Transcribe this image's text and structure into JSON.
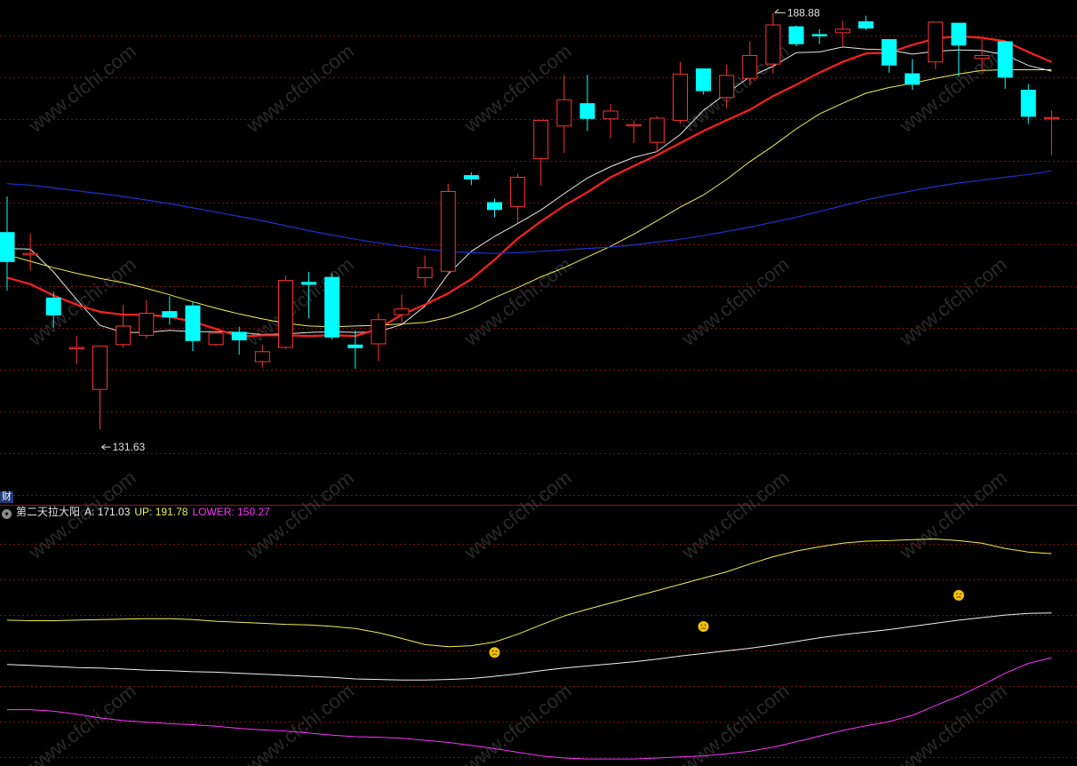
{
  "chart_data": {
    "type": "candlestick",
    "colors": {
      "up": "#ff3232",
      "down": "#00ffff",
      "ma_white": "#e8e8e8",
      "ma_red": "#ff2020",
      "ma_yellow": "#f0f050",
      "ma_blue": "#2030d0",
      "grid": "#7a1010",
      "A": "#f0f0f0",
      "UP": "#f0f050",
      "LOWER": "#ff32ff"
    },
    "price_range": [
      123.4,
      190.8
    ],
    "max_label": "188.88",
    "min_label": "131.63",
    "candles": [
      {
        "o": 159.2,
        "h": 164.2,
        "l": 151.0,
        "c": 155.0
      },
      {
        "o": 156.0,
        "h": 159.0,
        "l": 153.8,
        "c": 156.2
      },
      {
        "o": 150.0,
        "h": 150.8,
        "l": 145.8,
        "c": 147.5
      },
      {
        "o": 143.0,
        "h": 144.6,
        "l": 140.6,
        "c": 143.0
      },
      {
        "o": 137.1,
        "h": 143.2,
        "l": 131.5,
        "c": 143.2
      },
      {
        "o": 143.4,
        "h": 149.0,
        "l": 143.0,
        "c": 146.0
      },
      {
        "o": 144.7,
        "h": 149.6,
        "l": 144.3,
        "c": 147.8
      },
      {
        "o": 148.1,
        "h": 150.2,
        "l": 146.2,
        "c": 147.2
      },
      {
        "o": 148.9,
        "h": 149.4,
        "l": 142.5,
        "c": 143.9
      },
      {
        "o": 143.4,
        "h": 145.4,
        "l": 143.2,
        "c": 145.0
      },
      {
        "o": 145.2,
        "h": 145.9,
        "l": 142.0,
        "c": 144.0
      },
      {
        "o": 141.0,
        "h": 143.4,
        "l": 140.2,
        "c": 142.4
      },
      {
        "o": 143.0,
        "h": 153.1,
        "l": 142.8,
        "c": 152.4
      },
      {
        "o": 152.2,
        "h": 153.6,
        "l": 147.1,
        "c": 151.8
      },
      {
        "o": 152.9,
        "h": 153.4,
        "l": 144.1,
        "c": 144.4
      },
      {
        "o": 143.4,
        "h": 145.4,
        "l": 140.0,
        "c": 142.9
      },
      {
        "o": 143.5,
        "h": 147.8,
        "l": 141.1,
        "c": 146.9
      },
      {
        "o": 147.6,
        "h": 150.4,
        "l": 146.3,
        "c": 148.4
      },
      {
        "o": 152.8,
        "h": 155.9,
        "l": 151.4,
        "c": 154.2
      },
      {
        "o": 153.7,
        "h": 166.0,
        "l": 153.5,
        "c": 164.9
      },
      {
        "o": 167.2,
        "h": 167.6,
        "l": 165.8,
        "c": 166.6
      },
      {
        "o": 163.4,
        "h": 163.9,
        "l": 161.3,
        "c": 162.3
      },
      {
        "o": 162.8,
        "h": 167.4,
        "l": 160.5,
        "c": 166.9
      },
      {
        "o": 169.5,
        "h": 171.5,
        "l": 165.7,
        "c": 174.9
      },
      {
        "o": 174.1,
        "h": 181.3,
        "l": 170.3,
        "c": 177.8
      },
      {
        "o": 177.3,
        "h": 181.3,
        "l": 173.4,
        "c": 175.1
      },
      {
        "o": 175.1,
        "h": 177.2,
        "l": 172.4,
        "c": 176.2
      },
      {
        "o": 174.3,
        "h": 174.9,
        "l": 171.7,
        "c": 174.3
      },
      {
        "o": 171.8,
        "h": 175.5,
        "l": 170.4,
        "c": 175.2
      },
      {
        "o": 174.9,
        "h": 183.1,
        "l": 174.4,
        "c": 181.4
      },
      {
        "o": 182.2,
        "h": 181.8,
        "l": 178.5,
        "c": 179.0
      },
      {
        "o": 178.1,
        "h": 182.7,
        "l": 176.6,
        "c": 181.2
      },
      {
        "o": 180.8,
        "h": 186.0,
        "l": 179.8,
        "c": 184.0
      },
      {
        "o": 182.8,
        "h": 190.0,
        "l": 181.4,
        "c": 188.3
      },
      {
        "o": 188.1,
        "h": 188.2,
        "l": 185.3,
        "c": 185.6
      },
      {
        "o": 187.0,
        "h": 187.7,
        "l": 185.6,
        "c": 186.7
      },
      {
        "o": 187.2,
        "h": 188.9,
        "l": 185.4,
        "c": 187.7
      },
      {
        "o": 188.8,
        "h": 189.6,
        "l": 187.6,
        "c": 187.8
      },
      {
        "o": 186.3,
        "h": 186.3,
        "l": 181.6,
        "c": 182.6
      },
      {
        "o": 181.5,
        "h": 183.5,
        "l": 179.2,
        "c": 179.9
      },
      {
        "o": 183.1,
        "h": 188.6,
        "l": 182.1,
        "c": 188.7
      },
      {
        "o": 188.6,
        "h": 187.9,
        "l": 181.0,
        "c": 185.4
      },
      {
        "o": 183.6,
        "h": 186.3,
        "l": 181.6,
        "c": 184.0
      },
      {
        "o": 186.0,
        "h": 186.0,
        "l": 179.3,
        "c": 180.9
      },
      {
        "o": 179.2,
        "h": 180.0,
        "l": 174.4,
        "c": 175.4
      },
      {
        "o": 175.3,
        "h": 176.3,
        "l": 170.0,
        "c": 175.3
      }
    ],
    "ma_series": [
      {
        "key": "ma_white",
        "x_start": 0,
        "values": [
          156.9,
          156.8,
          153.6,
          149.7,
          146.1,
          145.1,
          145.1,
          145.4,
          145.2,
          145.2,
          145.1,
          144.8,
          144.9,
          145.1,
          145.2,
          145.1,
          145.2,
          146.2,
          148.8,
          153.3,
          156.5,
          158.6,
          160.4,
          162.3,
          164.6,
          166.8,
          168.4,
          169.7,
          170.5,
          172.9,
          176.3,
          178.7,
          181.0,
          182.5,
          184.4,
          184.5,
          185.2,
          184.9,
          184.8,
          184.2,
          184.6,
          184.8,
          184.7,
          184.1,
          182.6,
          181.8
        ]
      },
      {
        "key": "ma_red",
        "x_start": 0,
        "values": [
          152.8,
          151.9,
          150.3,
          149.0,
          148.0,
          147.6,
          147.6,
          147.3,
          146.6,
          145.6,
          144.5,
          144.7,
          144.7,
          144.6,
          144.7,
          144.6,
          145.6,
          147.6,
          149.0,
          150.6,
          152.6,
          155.3,
          158.3,
          160.7,
          162.9,
          164.8,
          166.9,
          168.5,
          170.0,
          171.7,
          173.4,
          174.9,
          176.4,
          178.3,
          179.9,
          181.6,
          183.1,
          184.3,
          184.4,
          185.5,
          186.4,
          186.7,
          186.5,
          186.0,
          184.5,
          183.1
        ]
      },
      {
        "key": "ma_yellow",
        "x_start": 0,
        "values": [
          156.0,
          155.1,
          154.2,
          153.4,
          152.7,
          152.1,
          151.3,
          150.4,
          149.4,
          148.5,
          147.7,
          147.0,
          146.4,
          146.0,
          145.9,
          146.0,
          146.1,
          146.3,
          146.5,
          147.2,
          148.4,
          150.0,
          151.4,
          152.9,
          154.2,
          155.7,
          157.2,
          158.9,
          160.8,
          162.7,
          164.4,
          166.6,
          169.1,
          171.3,
          173.7,
          175.8,
          177.3,
          178.7,
          179.5,
          180.1,
          180.8,
          181.4,
          181.9,
          182.0,
          182.0,
          182.0
        ]
      },
      {
        "key": "ma_blue",
        "x_start": 0,
        "values": [
          166.0,
          165.8,
          165.4,
          165.0,
          164.6,
          164.2,
          163.7,
          163.2,
          162.6,
          162.0,
          161.4,
          160.8,
          160.1,
          159.4,
          158.8,
          158.2,
          157.7,
          157.2,
          156.8,
          156.5,
          156.3,
          156.2,
          156.3,
          156.5,
          156.7,
          156.9,
          157.1,
          157.4,
          157.8,
          158.2,
          158.7,
          159.3,
          159.9,
          160.6,
          161.3,
          162.1,
          162.9,
          163.7,
          164.4,
          165.0,
          165.6,
          166.1,
          166.5,
          166.9,
          167.3,
          167.8
        ]
      }
    ],
    "indicator": {
      "name": "第二天拉大阳",
      "labels": [
        {
          "key": "A",
          "text": "A: 171.03"
        },
        {
          "key": "UP",
          "text": "UP: 191.78"
        },
        {
          "key": "LOWER",
          "text": "LOWER: 150.27"
        }
      ],
      "range": [
        149.0,
        196.0
      ],
      "signals": [
        21,
        30,
        41
      ],
      "signal_levels": [
        170.5,
        175.5,
        181.5
      ],
      "series": [
        {
          "key": "A",
          "values": [
            168.2,
            168.0,
            167.8,
            167.6,
            167.5,
            167.3,
            167.1,
            167.0,
            166.8,
            166.7,
            166.5,
            166.3,
            166.1,
            165.9,
            165.7,
            165.4,
            165.3,
            165.2,
            165.2,
            165.3,
            165.5,
            165.9,
            166.4,
            167.0,
            167.5,
            167.9,
            168.3,
            168.7,
            169.2,
            169.8,
            170.3,
            170.8,
            171.3,
            171.9,
            172.6,
            173.3,
            173.9,
            174.4,
            174.9,
            175.5,
            176.1,
            176.7,
            177.2,
            177.7,
            178.0,
            178.1
          ]
        },
        {
          "key": "UP",
          "values": [
            176.7,
            176.6,
            176.6,
            176.7,
            176.8,
            176.9,
            177.0,
            177.0,
            176.8,
            176.5,
            176.3,
            176.1,
            175.9,
            175.8,
            175.5,
            175.1,
            174.3,
            173.2,
            172.0,
            171.6,
            171.8,
            172.5,
            174.0,
            175.8,
            177.5,
            178.8,
            180.0,
            181.2,
            182.4,
            183.6,
            184.8,
            186.0,
            187.5,
            188.9,
            190.0,
            190.8,
            191.5,
            191.9,
            192.0,
            192.2,
            192.3,
            192.0,
            191.5,
            190.5,
            189.8,
            189.5
          ]
        },
        {
          "key": "LOWER",
          "values": [
            159.5,
            159.5,
            159.2,
            158.6,
            157.9,
            157.4,
            157.1,
            156.8,
            156.6,
            156.3,
            155.9,
            155.6,
            155.4,
            155.0,
            154.6,
            154.3,
            154.2,
            154.0,
            153.6,
            153.2,
            152.6,
            152.0,
            151.3,
            150.6,
            150.2,
            150.0,
            150.0,
            150.0,
            150.2,
            150.4,
            150.6,
            151.0,
            151.5,
            152.3,
            153.3,
            154.4,
            155.5,
            156.4,
            157.2,
            158.4,
            160.3,
            162.1,
            164.2,
            166.5,
            168.4,
            169.5
          ]
        }
      ]
    }
  }
}
